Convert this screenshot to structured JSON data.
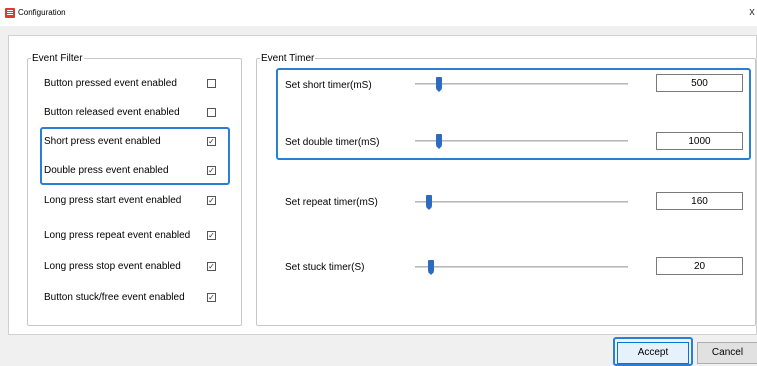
{
  "window": {
    "title": "Configuration",
    "close_glyph": "x",
    "app_icon": "app-icon",
    "accent": "#2a7fd4"
  },
  "event_filter": {
    "legend": "Event Filter",
    "items": [
      {
        "label": "Button pressed event enabled",
        "checked": false,
        "mark": ""
      },
      {
        "label": "Button released event enabled",
        "checked": false,
        "mark": ""
      },
      {
        "label": "Short press event enabled",
        "checked": true,
        "mark": "✓"
      },
      {
        "label": "Double press event enabled",
        "checked": true,
        "mark": "✓"
      },
      {
        "label": "Long press start event enabled",
        "checked": true,
        "mark": "✓"
      },
      {
        "label": "Long press repeat event enabled",
        "checked": true,
        "mark": "✓"
      },
      {
        "label": "Long press stop event enabled",
        "checked": true,
        "mark": "✓"
      },
      {
        "label": "Button stuck/free event enabled",
        "checked": true,
        "mark": "✓"
      }
    ]
  },
  "event_timer": {
    "legend": "Event Timer",
    "rows": [
      {
        "label": "Set short timer(mS)",
        "value": "500",
        "slider_level": 0.1
      },
      {
        "label": "Set double timer(mS)",
        "value": "1000",
        "slider_level": 0.1
      },
      {
        "label": "Set repeat timer(mS)",
        "value": "160",
        "slider_level": 0.05
      },
      {
        "label": "Set stuck timer(S)",
        "value": "20",
        "slider_level": 0.06
      }
    ]
  },
  "buttons": {
    "accept": "Accept",
    "cancel": "Cancel"
  }
}
